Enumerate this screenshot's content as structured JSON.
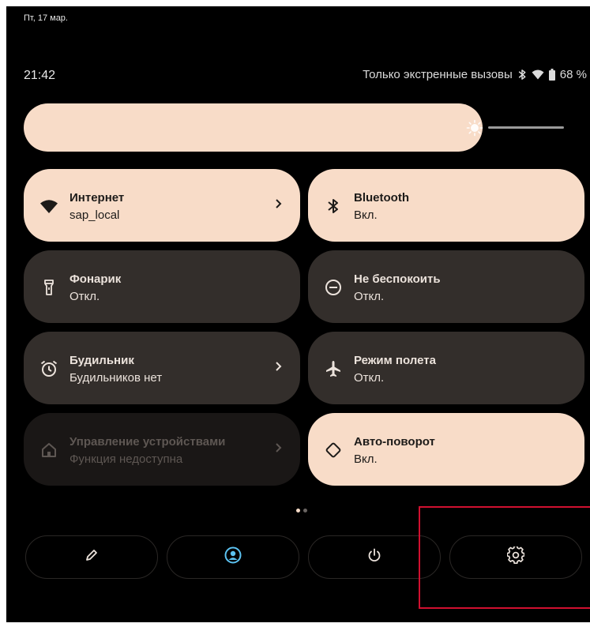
{
  "status_bar": {
    "date": "Пт, 17 мар.",
    "time": "21:42",
    "network_status": "Только экстренные вызовы",
    "battery": "68 %",
    "icons": [
      "bluetooth-icon",
      "wifi-icon",
      "battery-icon"
    ]
  },
  "brightness": {
    "level": 0.85,
    "icon": "sun-icon"
  },
  "tiles": [
    {
      "title": "Интернет",
      "subtitle": "sap_local",
      "icon": "wifi-icon",
      "state": "on",
      "chevron": true
    },
    {
      "title": "Bluetooth",
      "subtitle": "Вкл.",
      "icon": "bluetooth-icon",
      "state": "on",
      "chevron": false
    },
    {
      "title": "Фонарик",
      "subtitle": "Откл.",
      "icon": "flashlight-icon",
      "state": "off",
      "chevron": false
    },
    {
      "title": "Не  беспокоить",
      "subtitle": "Откл.",
      "icon": "do-not-disturb-icon",
      "state": "off",
      "chevron": false
    },
    {
      "title": "Будильник",
      "subtitle": "Будильников нет",
      "icon": "alarm-icon",
      "state": "off",
      "chevron": true
    },
    {
      "title": "Режим полета",
      "subtitle": "Откл.",
      "icon": "airplane-icon",
      "state": "off",
      "chevron": false
    },
    {
      "title": "Управление устройствами",
      "subtitle": "Функция недоступна",
      "icon": "home-icon",
      "state": "disabled",
      "chevron": true
    },
    {
      "title": "Авто-поворот",
      "subtitle": "Вкл.",
      "icon": "rotate-icon",
      "state": "on",
      "chevron": false
    }
  ],
  "page_indicator": {
    "current": 1,
    "total": 2
  },
  "bottom_buttons": [
    {
      "icon": "edit-icon"
    },
    {
      "icon": "user-icon"
    },
    {
      "icon": "power-icon"
    },
    {
      "icon": "settings-icon"
    }
  ],
  "colors": {
    "tile_on": "#f8dcc8",
    "tile_off": "#332e2b",
    "tile_disabled": "#1a1716",
    "accent_blue": "#5cc3f2",
    "highlight_box": "#d01030"
  }
}
